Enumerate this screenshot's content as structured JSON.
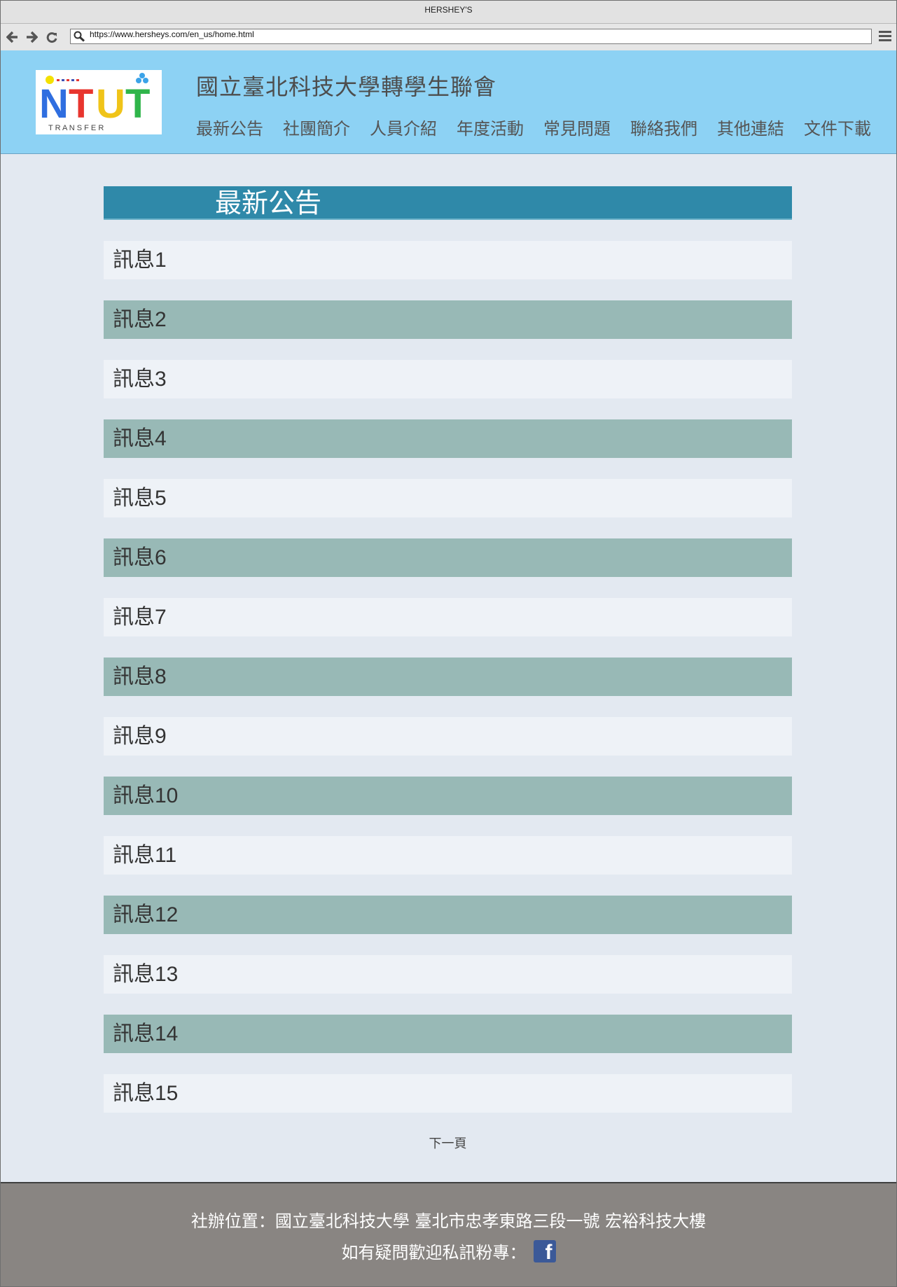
{
  "browser": {
    "window_title": "HERSHEY'S",
    "url": "https://www.hersheys.com/en_us/home.html"
  },
  "logo": {
    "text": "NTUT",
    "subtext": "T R A N S F E R"
  },
  "header": {
    "title": "國立臺北科技大學轉學生聯會",
    "nav": [
      "最新公告",
      "社團簡介",
      "人員介紹",
      "年度活動",
      "常見問題",
      "聯絡我們",
      "其他連結",
      "文件下載"
    ]
  },
  "main": {
    "section_title": "最新公告",
    "messages": [
      "訊息1",
      "訊息2",
      "訊息3",
      "訊息4",
      "訊息5",
      "訊息6",
      "訊息7",
      "訊息8",
      "訊息9",
      "訊息10",
      "訊息11",
      "訊息12",
      "訊息13",
      "訊息14",
      "訊息15"
    ],
    "next_page": "下一頁"
  },
  "footer": {
    "address": "社辦位置：國立臺北科技大學  臺北市忠孝東路三段一號  宏裕科技大樓",
    "contact": "如有疑問歡迎私訊粉專："
  },
  "colors": {
    "header_bg": "#8dd2f4",
    "section_head": "#2f89a9",
    "row_dark": "#98b9b6",
    "row_light": "#eef2f7",
    "footer_bg": "#898582",
    "facebook": "#3b5998"
  },
  "icons": [
    "back-arrow-icon",
    "forward-arrow-icon",
    "reload-icon",
    "search-icon",
    "hamburger-menu-icon",
    "facebook-icon"
  ]
}
